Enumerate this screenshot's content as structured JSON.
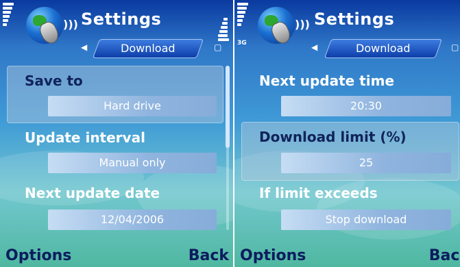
{
  "left": {
    "title": "Settings",
    "tab_label": "Download",
    "settings": [
      {
        "label": "Save to",
        "value": "Hard drive"
      },
      {
        "label": "Update interval",
        "value": "Manual only"
      },
      {
        "label": "Next update date",
        "value": "12/04/2006"
      }
    ],
    "softkey_left": "Options",
    "softkey_right": "Back"
  },
  "right": {
    "title": "Settings",
    "tab_label": "Download",
    "network_label": "3G",
    "settings": [
      {
        "label": "Next update time",
        "value": "20:30"
      },
      {
        "label": "Download limit (%)",
        "value": "25"
      },
      {
        "label": "If limit exceeds",
        "value": "Stop download"
      }
    ],
    "softkey_left": "Options",
    "softkey_right": "Back"
  },
  "icons": {
    "app": "globe-satellite-dish-icon",
    "signal": "signal-strength-icon",
    "battery": "battery-icon",
    "tab_left": "arrow-left-icon",
    "tab_right": "arrow-right-icon"
  }
}
